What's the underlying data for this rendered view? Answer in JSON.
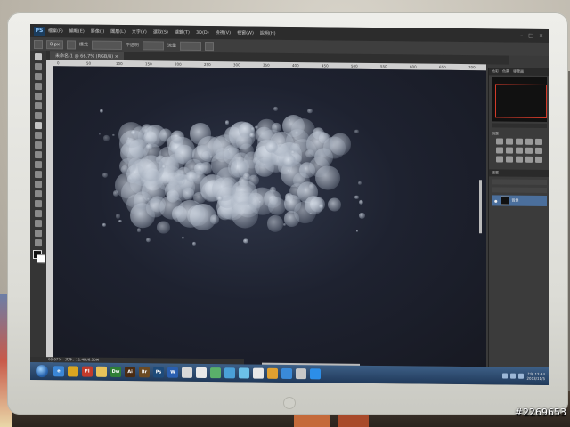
{
  "photo": {
    "watermark": "#2269653"
  },
  "app": {
    "logo": "PS",
    "menu": [
      "檔案(F)",
      "編輯(E)",
      "影像(I)",
      "圖層(L)",
      "文字(Y)",
      "選取(S)",
      "濾鏡(T)",
      "3D(D)",
      "檢視(V)",
      "視窗(W)",
      "說明(H)"
    ],
    "window_controls": [
      "–",
      "□",
      "×"
    ]
  },
  "options": {
    "brush_size": "8 px",
    "mode_label": "模式",
    "opacity_label": "不透明",
    "flow_label": "流量"
  },
  "document": {
    "tab": "未命名-1 @ 66.7% (RGB/8) ×",
    "ruler_ticks": [
      "0",
      "50",
      "100",
      "150",
      "200",
      "250",
      "300",
      "350",
      "400",
      "450",
      "500",
      "550",
      "600",
      "650",
      "700"
    ]
  },
  "status": {
    "zoom": "66.67%",
    "doc_info": "文件：11.4M/6.30M"
  },
  "panels": {
    "top_tabs": [
      "色彩",
      "色票",
      "導覽器"
    ],
    "adjust_title": "調整",
    "layer_name": "背景",
    "layers_tab": "圖層"
  },
  "taskbar": {
    "apps": [
      {
        "name": "ie",
        "label": "e",
        "color": "#3b86d6"
      },
      {
        "name": "chrome",
        "label": "",
        "color": "#d9a520"
      },
      {
        "name": "flash",
        "label": "Fl",
        "color": "#c23b2b"
      },
      {
        "name": "folder",
        "label": "",
        "color": "#e7c25a"
      },
      {
        "name": "dreamweaver",
        "label": "Dw",
        "color": "#2f7f37"
      },
      {
        "name": "illustrator",
        "label": "Ai",
        "color": "#4a2b12"
      },
      {
        "name": "bridge",
        "label": "Br",
        "color": "#6b4a22"
      },
      {
        "name": "photoshop",
        "label": "Ps",
        "color": "#1e4b7a"
      },
      {
        "name": "word",
        "label": "W",
        "color": "#2a5fb0"
      },
      {
        "name": "app-10",
        "label": "",
        "color": "#d8d8d8"
      },
      {
        "name": "app-11",
        "label": "",
        "color": "#e9e9e9"
      },
      {
        "name": "app-12",
        "label": "",
        "color": "#5ab06a"
      },
      {
        "name": "app-13",
        "label": "",
        "color": "#4aa0d8"
      },
      {
        "name": "app-14",
        "label": "",
        "color": "#6cc0e8"
      },
      {
        "name": "app-15",
        "label": "",
        "color": "#e8e8e8"
      },
      {
        "name": "app-16",
        "label": "",
        "color": "#e0a030"
      },
      {
        "name": "app-17",
        "label": "",
        "color": "#3a8ad8"
      },
      {
        "name": "app-18",
        "label": "",
        "color": "#c8c8c8"
      },
      {
        "name": "app-19",
        "label": "",
        "color": "#2c8ee8"
      }
    ],
    "time": "上午 12:34",
    "date": "2013/11/5"
  }
}
